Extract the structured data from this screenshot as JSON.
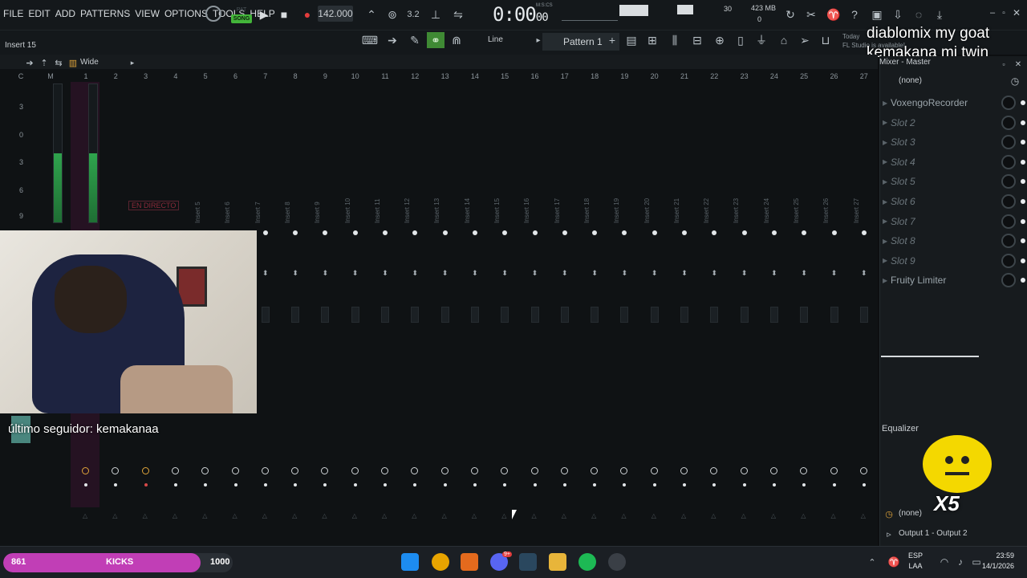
{
  "menu": [
    "FILE",
    "EDIT",
    "ADD",
    "PATTERNS",
    "VIEW",
    "OPTIONS",
    "TOOLS",
    "HELP"
  ],
  "transport": {
    "pat": "PAT",
    "song": "SONG",
    "tempo": "142.000",
    "time_main": "0:00",
    "time_sub": "00",
    "time_unit": "M:S:CS",
    "cpu_top": "30",
    "mem": "423 MB",
    "poly": "0"
  },
  "toolbar2": {
    "line_label": "Line",
    "pattern_label": "Pattern 1",
    "hint_line1": "Today",
    "hint_line2": "FL Studio is available!"
  },
  "overlay": {
    "line1": "diablomix my goat",
    "line2": "kemakana mi twin"
  },
  "mixer": {
    "selected_insert": "Insert 15",
    "view_label": "Wide",
    "col_c": "C",
    "col_m": "M",
    "columns": [
      "1",
      "2",
      "3",
      "4",
      "5",
      "6",
      "7",
      "8",
      "9",
      "10",
      "11",
      "12",
      "13",
      "14",
      "15",
      "16",
      "17",
      "18",
      "19",
      "20",
      "21",
      "22",
      "23",
      "24",
      "25",
      "26",
      "27"
    ],
    "insert_labels": [
      "Insert 5",
      "Insert 6",
      "Insert 7",
      "Insert 8",
      "Insert 9",
      "Insert 10",
      "Insert 11",
      "Insert 12",
      "Insert 13",
      "Insert 14",
      "Insert 15",
      "Insert 16",
      "Insert 17",
      "Insert 18",
      "Insert 19",
      "Insert 20",
      "Insert 21",
      "Insert 22",
      "Insert 23",
      "Insert 24",
      "Insert 25",
      "Insert 26",
      "Insert 27"
    ],
    "db_marks": [
      "3",
      "0",
      "3",
      "6",
      "9"
    ],
    "live_badge": "EN DIRECTO"
  },
  "stream": {
    "follower": "último seguidor: kemakanaa"
  },
  "right_panel": {
    "title": "Mixer - Master",
    "input": "(none)",
    "slots": [
      {
        "name": "VoxengoRecorder",
        "active": true
      },
      {
        "name": "Slot 2",
        "active": false
      },
      {
        "name": "Slot 3",
        "active": false
      },
      {
        "name": "Slot 4",
        "active": false
      },
      {
        "name": "Slot 5",
        "active": false
      },
      {
        "name": "Slot 6",
        "active": false
      },
      {
        "name": "Slot 7",
        "active": false
      },
      {
        "name": "Slot 8",
        "active": false
      },
      {
        "name": "Slot 9",
        "active": false
      },
      {
        "name": "Fruity Limiter",
        "active": true
      }
    ],
    "equalizer": "Equalizer",
    "output_none": "(none)",
    "output": "Output 1 - Output 2",
    "emote_text": "X5"
  },
  "taskbar": {
    "goal_current": "861",
    "goal_label": "KICKS",
    "goal_target": "1000",
    "goal_fraction": 0.861,
    "lang_line1": "ESP",
    "lang_line2": "LAA",
    "time": "23:59",
    "date": "14/1/2026",
    "discord_badge": "9+"
  },
  "colors": {
    "accent_green": "#43b53a",
    "goal_pink": "#c13eb6",
    "record_red": "#e23c3c"
  }
}
